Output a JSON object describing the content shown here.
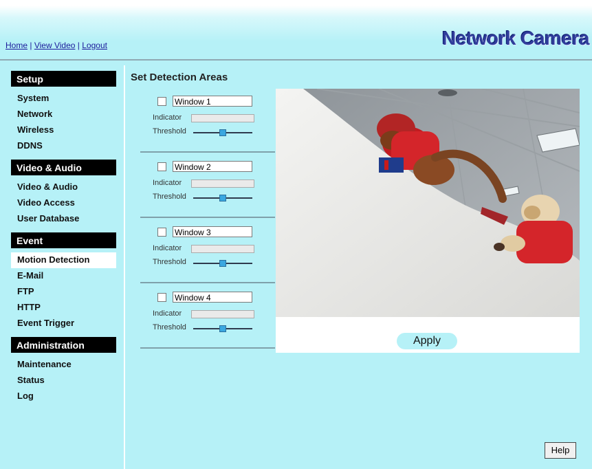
{
  "header": {
    "links": [
      "Home",
      "View Video",
      "Logout"
    ],
    "separator": "|",
    "brand": "Network Camera"
  },
  "sidebar": {
    "sections": [
      {
        "title": "Setup",
        "items": [
          "System",
          "Network",
          "Wireless",
          "DDNS"
        ]
      },
      {
        "title": "Video & Audio",
        "items": [
          "Video & Audio",
          "Video Access",
          "User Database"
        ]
      },
      {
        "title": "Event",
        "items": [
          "Motion Detection",
          "E-Mail",
          "FTP",
          "HTTP",
          "Event Trigger"
        ]
      },
      {
        "title": "Administration",
        "items": [
          "Maintenance",
          "Status",
          "Log"
        ]
      }
    ],
    "active_item": "Motion Detection"
  },
  "main": {
    "title": "Set Detection Areas",
    "windows": [
      {
        "name": "Window 1",
        "checked": false,
        "indicator_label": "Indicator",
        "threshold_label": "Threshold",
        "threshold_level": 0.5
      },
      {
        "name": "Window 2",
        "checked": false,
        "indicator_label": "Indicator",
        "threshold_label": "Threshold",
        "threshold_level": 0.5
      },
      {
        "name": "Window 3",
        "checked": false,
        "indicator_label": "Indicator",
        "threshold_label": "Threshold",
        "threshold_level": 0.5
      },
      {
        "name": "Window 4",
        "checked": false,
        "indicator_label": "Indicator",
        "threshold_label": "Threshold",
        "threshold_level": 0.5
      }
    ],
    "apply_label": "Apply",
    "help_label": "Help"
  },
  "colors": {
    "background": "#b6f1f7",
    "brand": "#2f3d9b",
    "link": "#1a1a9a",
    "section_header": "#000000"
  }
}
